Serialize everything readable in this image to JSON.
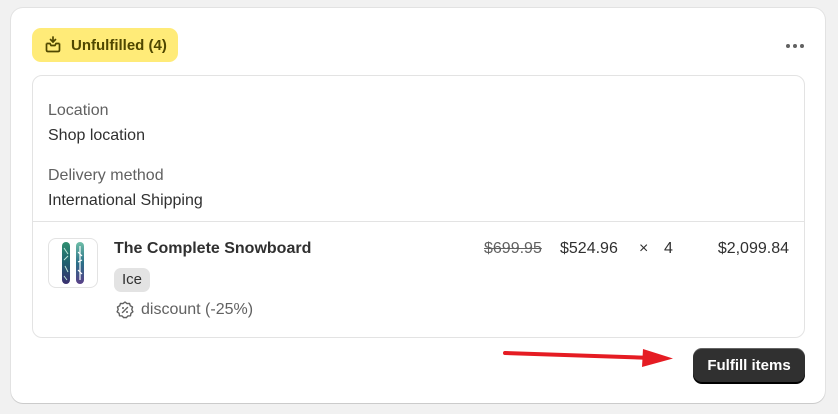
{
  "header": {
    "status_label": "Unfulfilled (4)",
    "status_icon": "fulfillment-pending-icon",
    "more_icon": "more-horizontal-icon"
  },
  "details": {
    "location_label": "Location",
    "location_value": "Shop location",
    "delivery_label": "Delivery method",
    "delivery_value": "International Shipping"
  },
  "line_item": {
    "product_name": "The Complete Snowboard",
    "variant": "Ice",
    "discount_label": "discount (-25%)",
    "discount_icon": "discount-badge-icon",
    "original_price": "$699.95",
    "sale_price": "$524.96",
    "times_symbol": "×",
    "quantity": "4",
    "line_total": "$2,099.84"
  },
  "footer": {
    "fulfill_label": "Fulfill items"
  },
  "colors": {
    "status_badge_bg": "#ffeb78",
    "primary_button_bg": "#303030",
    "annotation_arrow": "#e51c23"
  }
}
